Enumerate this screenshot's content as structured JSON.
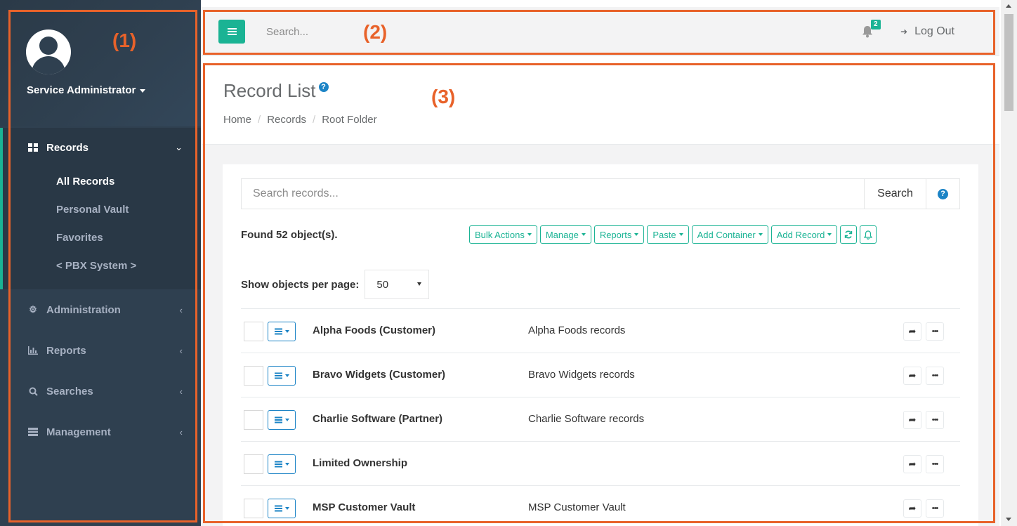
{
  "sidebar": {
    "profile_name": "Service Administrator",
    "records": {
      "label": "Records",
      "sub_items": [
        "All Records",
        "Personal Vault",
        "Favorites",
        "< PBX System >"
      ]
    },
    "items": [
      {
        "label": "Administration",
        "icon": "gear-icon"
      },
      {
        "label": "Reports",
        "icon": "bar-chart-icon"
      },
      {
        "label": "Searches",
        "icon": "search-icon"
      },
      {
        "label": "Management",
        "icon": "server-icon"
      }
    ]
  },
  "topbar": {
    "search_placeholder": "Search...",
    "notification_count": "2",
    "logout_label": "Log Out"
  },
  "page": {
    "title": "Record List",
    "breadcrumb": [
      "Home",
      "Records",
      "Root Folder"
    ]
  },
  "records_panel": {
    "search_placeholder": "Search records...",
    "search_button": "Search",
    "found_text": "Found 52 object(s).",
    "actions": [
      "Bulk Actions",
      "Manage",
      "Reports",
      "Paste",
      "Add Container",
      "Add Record"
    ],
    "per_page_label": "Show objects per page:",
    "per_page_value": "50",
    "rows": [
      {
        "name": "Alpha Foods (Customer)",
        "description": "Alpha Foods records"
      },
      {
        "name": "Bravo Widgets (Customer)",
        "description": "Bravo Widgets records"
      },
      {
        "name": "Charlie Software (Partner)",
        "description": "Charlie Software records"
      },
      {
        "name": "Limited Ownership",
        "description": ""
      },
      {
        "name": "MSP Customer Vault",
        "description": "MSP Customer Vault"
      }
    ]
  },
  "annotations": {
    "sidebar": "(1)",
    "topbar": "(2)",
    "main": "(3)"
  },
  "colors": {
    "accent": "#1ab394",
    "sidebar_bg": "#2f4050",
    "annotation": "#e8622a",
    "help_blue": "#1c84c6"
  }
}
